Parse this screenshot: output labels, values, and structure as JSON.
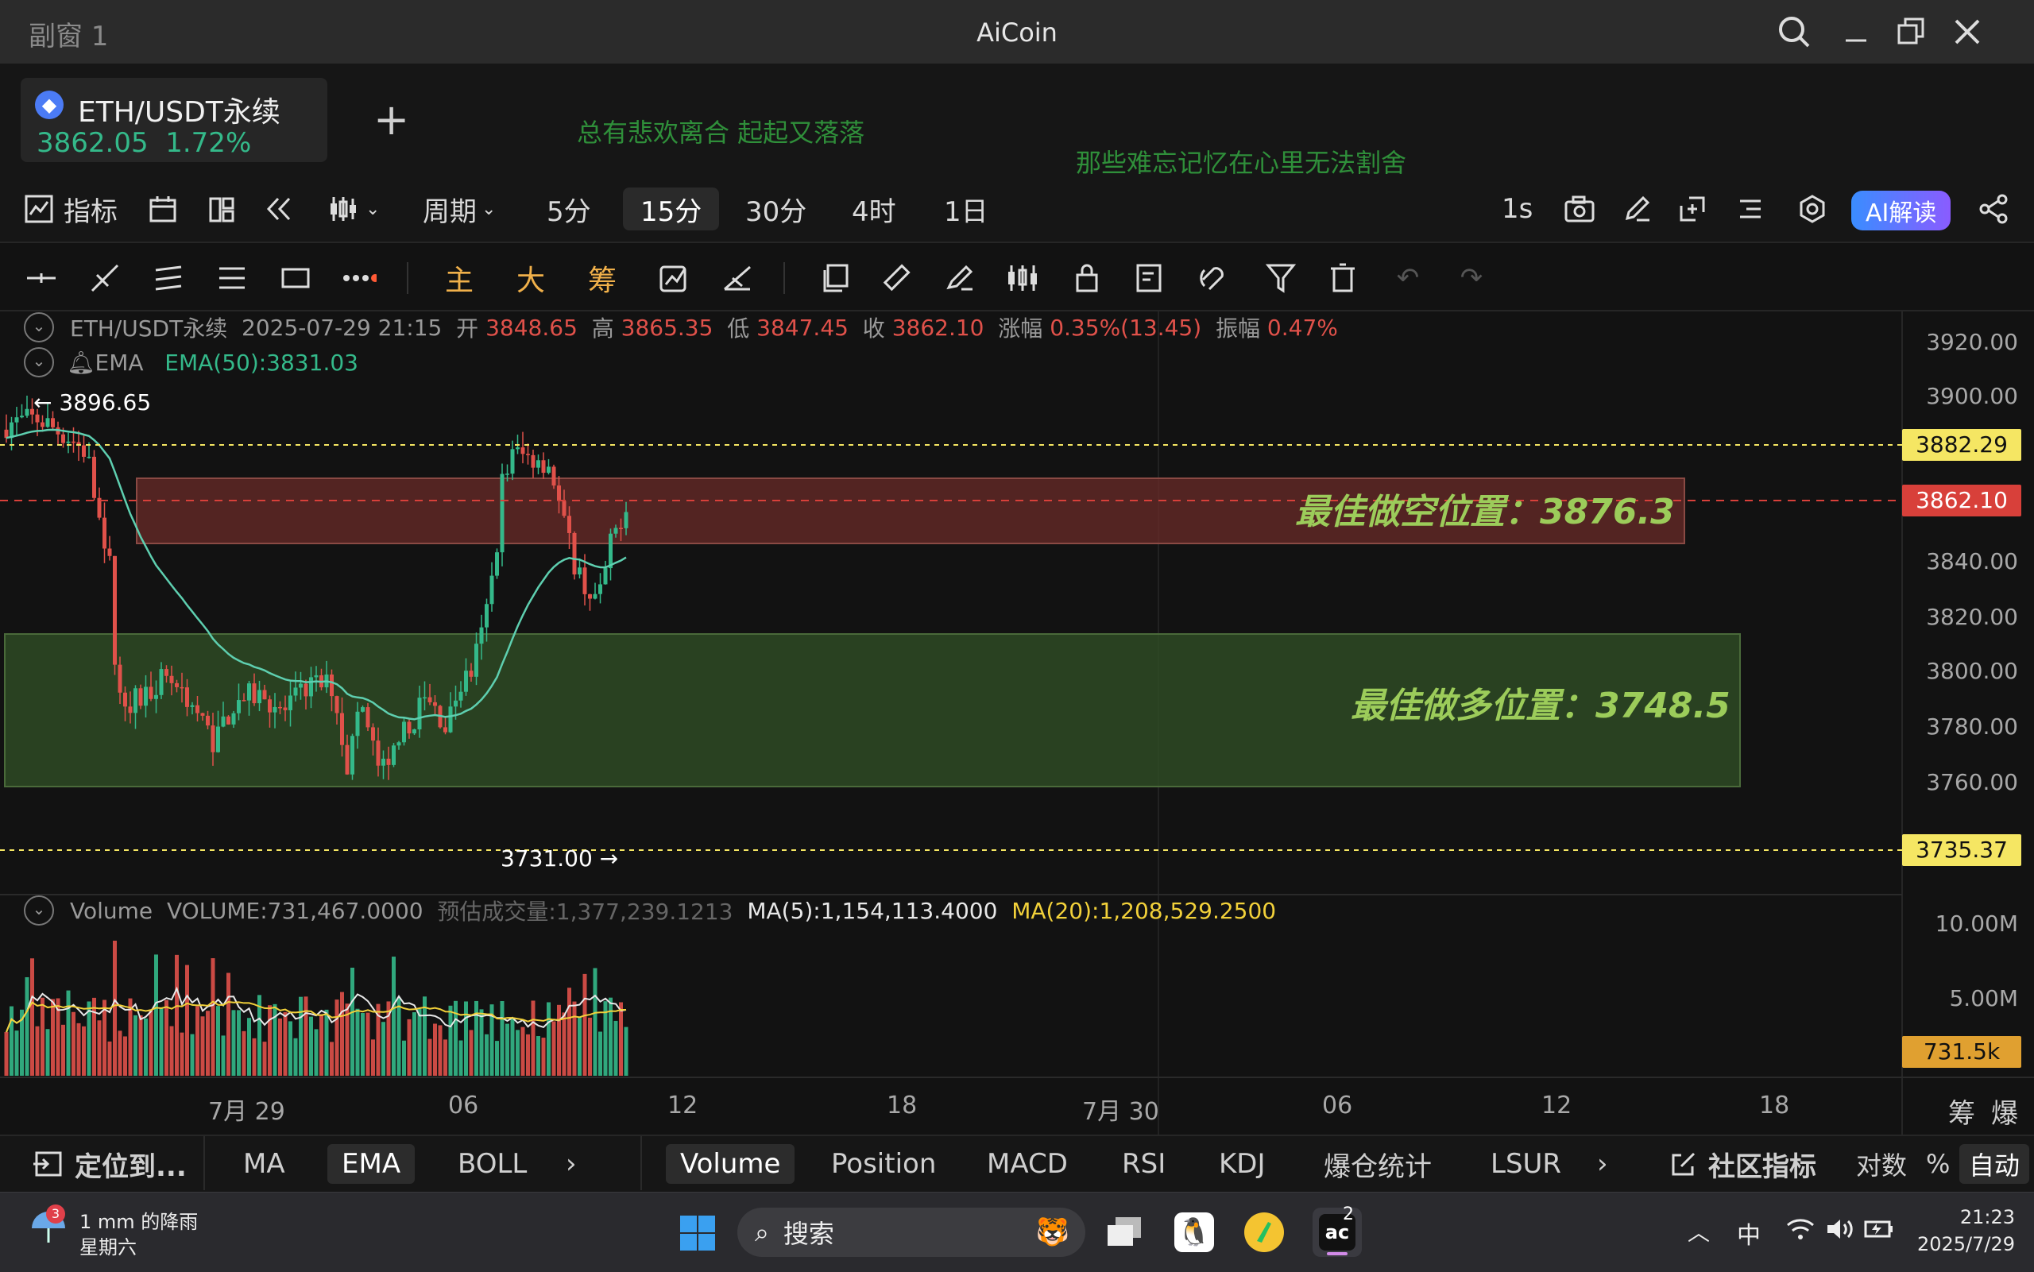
{
  "window": {
    "tab_title": "副窗 1",
    "app_title": "AiCoin"
  },
  "ticker": {
    "pair": "ETH/USDT永续",
    "price": "3862.05",
    "change": "1.72%",
    "add_label": "+"
  },
  "lyrics": {
    "line1": "总有悲欢离合  起起又落落",
    "line2": "那些难忘记忆在心里无法割舍"
  },
  "toolbar": {
    "indicator": "指标",
    "period": "周期",
    "intervals": [
      "5分",
      "15分",
      "30分",
      "4时",
      "1日"
    ],
    "active_interval": "15分",
    "refresh": "1s",
    "ai": "AI解读"
  },
  "drawbar": {
    "main": "主",
    "big": "大",
    "chip": "筹"
  },
  "chart": {
    "info": {
      "pair": "ETH/USDT永续",
      "time": "2025-07-29 21:15",
      "open_lbl": "开",
      "open": "3848.65",
      "high_lbl": "高",
      "high": "3865.35",
      "low_lbl": "低",
      "low": "3847.45",
      "close_lbl": "收",
      "close": "3862.10",
      "chg_lbl": "涨幅",
      "chg": "0.35%(13.45)",
      "amp_lbl": "振幅",
      "amp": "0.47%"
    },
    "ema": {
      "label": "EMA",
      "value": "EMA(50):3831.03"
    },
    "high_marker": "3896.65",
    "low_marker": "3731.00",
    "short_zone": "最佳做空位置：3876.3",
    "long_zone": "最佳做多位置：3748.5",
    "price_axis": [
      "3920.00",
      "3900.00",
      "3840.00",
      "3820.00",
      "3800.00",
      "3780.00",
      "3760.00"
    ],
    "tag_high": "3882.29",
    "tag_last": "3862.10",
    "tag_low": "3735.37",
    "volume": {
      "label": "Volume",
      "value": "VOLUME:731,467.0000",
      "est": "预估成交量:1,377,239.1213",
      "ma5": "MA(5):1,154,113.4000",
      "ma20": "MA(20):1,208,529.2500",
      "axis": [
        "10.00M",
        "5.00M"
      ],
      "tag": "731.5k"
    },
    "time_axis": [
      "7月 29",
      "06",
      "12",
      "18",
      "7月 30",
      "06",
      "12",
      "18"
    ],
    "corner": {
      "chip": "筹",
      "boom": "爆"
    }
  },
  "bottom_tabs": {
    "locate": "定位到...",
    "main": [
      "MA",
      "EMA",
      "BOLL"
    ],
    "main_active": "EMA",
    "sub": [
      "Volume",
      "Position",
      "MACD",
      "RSI",
      "KDJ",
      "爆仓统计",
      "LSUR"
    ],
    "sub_active": "Volume",
    "community": "社区指标",
    "log": "对数",
    "pct": "%",
    "auto": "自动"
  },
  "taskbar": {
    "weather_badge": "3",
    "weather": "1 mm 的降雨",
    "day": "星期六",
    "search": "搜索",
    "app_badge": "2",
    "ime": "中",
    "time": "21:23",
    "date": "2025/7/29"
  },
  "colors": {
    "up": "#34b98a",
    "down": "#e0514a",
    "short_zone": "#6a2b28",
    "long_zone": "#2e4a25",
    "zone_text": "#9ccc5a"
  }
}
